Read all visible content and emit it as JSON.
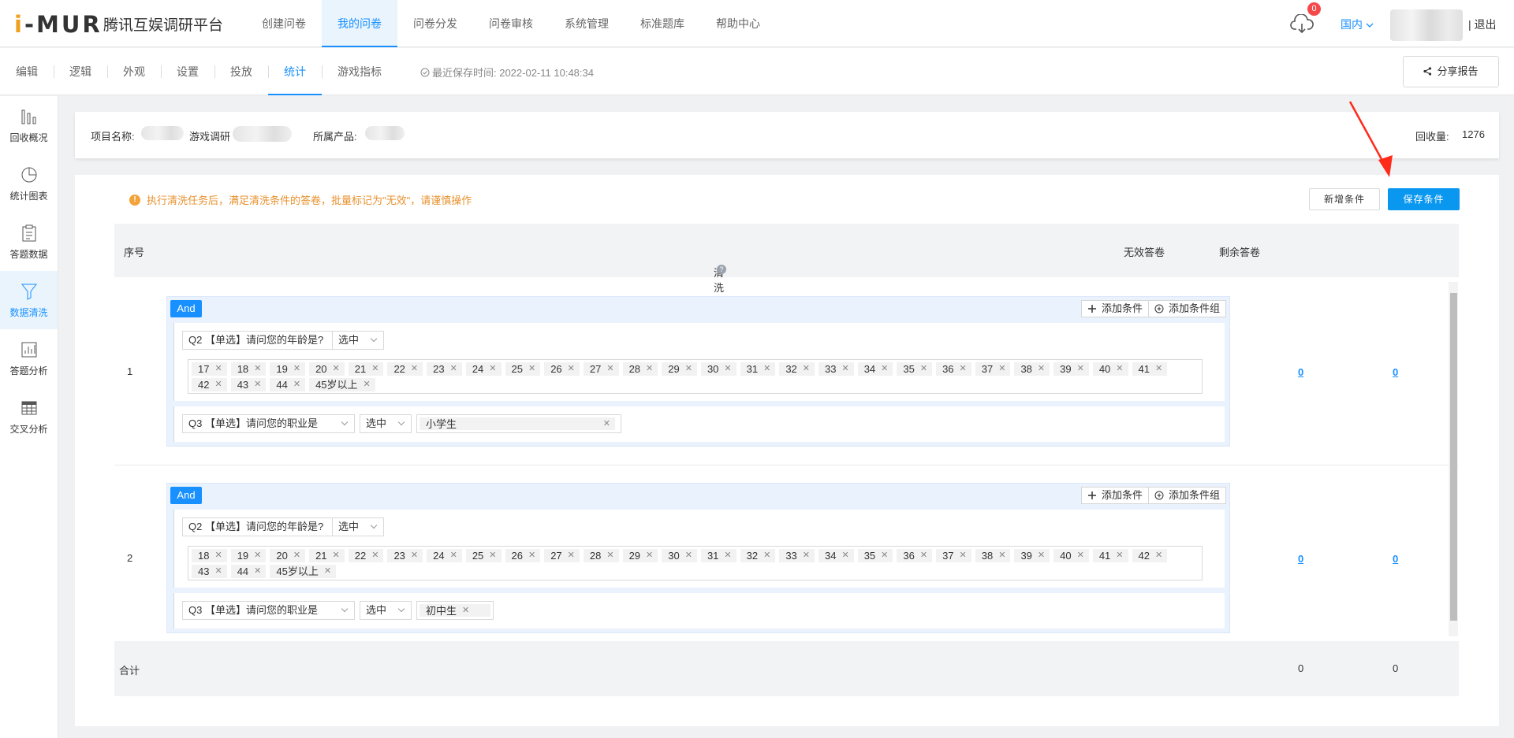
{
  "logo": {
    "text_a": "i",
    "text_b": "-MUR"
  },
  "platform_title": "腾讯互娱调研平台",
  "top_nav": [
    {
      "label": "创建问卷",
      "active": false
    },
    {
      "label": "我的问卷",
      "active": true
    },
    {
      "label": "问卷分发",
      "active": false
    },
    {
      "label": "问卷审核",
      "active": false
    },
    {
      "label": "系统管理",
      "active": false
    },
    {
      "label": "标准题库",
      "active": false
    },
    {
      "label": "帮助中心",
      "active": false
    }
  ],
  "header_right": {
    "notification_count": "0",
    "region": "国内",
    "logout": "| 退出"
  },
  "sub_nav": [
    {
      "label": "编辑",
      "active": false
    },
    {
      "label": "逻辑",
      "active": false
    },
    {
      "label": "外观",
      "active": false
    },
    {
      "label": "设置",
      "active": false
    },
    {
      "label": "投放",
      "active": false
    },
    {
      "label": "统计",
      "active": true
    },
    {
      "label": "游戏指标",
      "active": false
    }
  ],
  "save_time": "最近保存时间: 2022-02-11 10:48:34",
  "share_label": "分享报告",
  "sidebar": [
    {
      "label": "回收概况",
      "icon": "bar-chart-icon",
      "active": false
    },
    {
      "label": "统计图表",
      "icon": "pie-chart-icon",
      "active": false
    },
    {
      "label": "答题数据",
      "icon": "clipboard-icon",
      "active": false
    },
    {
      "label": "数据清洗",
      "icon": "filter-icon",
      "active": true
    },
    {
      "label": "答题分析",
      "icon": "analysis-icon",
      "active": false
    },
    {
      "label": "交叉分析",
      "icon": "table-icon",
      "active": false
    }
  ],
  "project": {
    "name_label": "项目名称:",
    "name_value": "游戏调研",
    "product_label": "所属产品:",
    "count_label": "回收量:",
    "count_value": "1276"
  },
  "warning": "执行清洗任务后，满足清洗条件的答卷，批量标记为\"无效\"，请谨慎操作",
  "buttons": {
    "add_condition": "新增条件",
    "save_condition": "保存条件"
  },
  "table": {
    "col_index": "序号",
    "col_condition": "清洗条件",
    "col_invalid": "无效答卷",
    "col_remaining": "剩余答卷"
  },
  "group_labels": {
    "and": "And",
    "add_cond": "添加条件",
    "add_group": "添加条件组"
  },
  "rows": [
    {
      "index": "1",
      "q2_select": "Q2 【单选】请问您的年龄是?",
      "q2_op": "选中",
      "q2_tags": [
        "17",
        "18",
        "19",
        "20",
        "21",
        "22",
        "23",
        "24",
        "25",
        "26",
        "27",
        "28",
        "29",
        "30",
        "31",
        "32",
        "33",
        "34",
        "35",
        "36",
        "37",
        "38",
        "39",
        "40",
        "41",
        "42",
        "43",
        "44",
        "45岁以上"
      ],
      "q3_select": "Q3 【单选】请问您的职业是",
      "q3_op": "选中",
      "q3_tag": "小学生",
      "invalid": "0",
      "remaining": "0"
    },
    {
      "index": "2",
      "q2_select": "Q2 【单选】请问您的年龄是?",
      "q2_op": "选中",
      "q2_tags": [
        "18",
        "19",
        "20",
        "21",
        "22",
        "23",
        "24",
        "25",
        "26",
        "27",
        "28",
        "29",
        "30",
        "31",
        "32",
        "33",
        "34",
        "35",
        "36",
        "37",
        "38",
        "39",
        "40",
        "41",
        "42",
        "43",
        "44",
        "45岁以上"
      ],
      "q3_select": "Q3 【单选】请问您的职业是",
      "q3_op": "选中",
      "q3_tag": "初中生",
      "invalid": "0",
      "remaining": "0"
    }
  ],
  "total": {
    "label": "合计",
    "invalid": "0",
    "remaining": "0"
  },
  "colors": {
    "accent": "#1890ff",
    "save_button": "#0a97f0",
    "warning": "#e8912d",
    "badge": "#f5484b",
    "annotation_arrow": "#ff2a1a"
  }
}
